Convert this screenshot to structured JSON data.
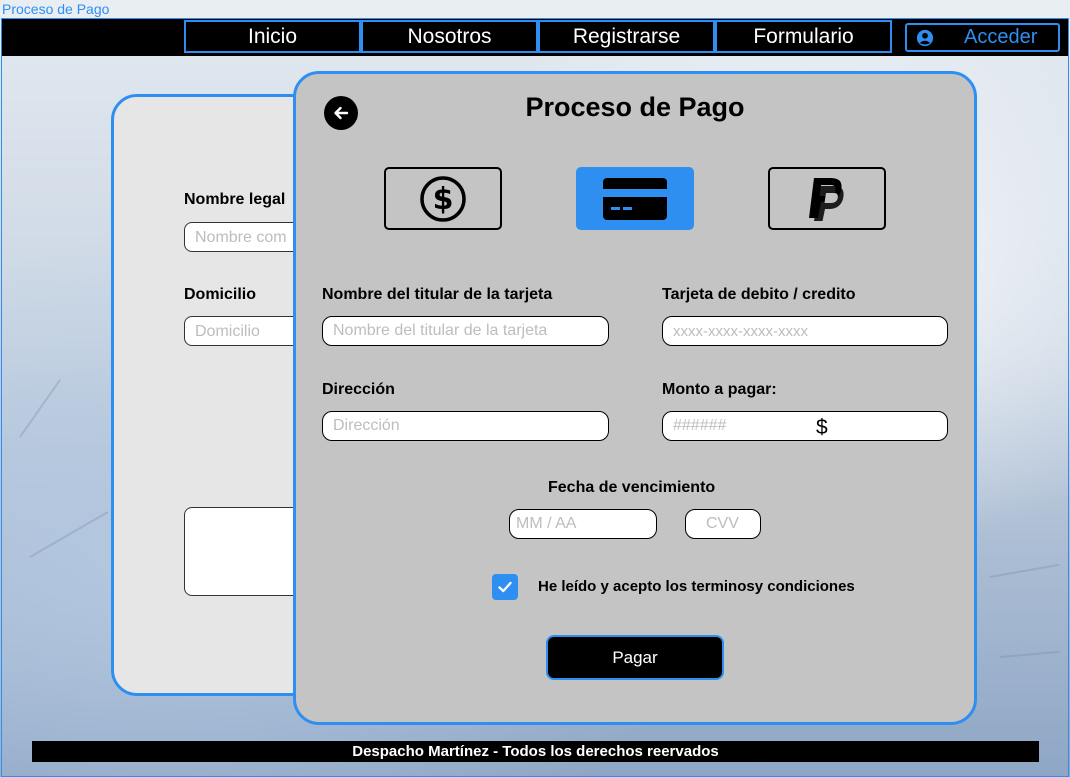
{
  "window": {
    "tab_title": "Proceso de Pago"
  },
  "navbar": {
    "items": [
      {
        "label": "Inicio"
      },
      {
        "label": "Nosotros"
      },
      {
        "label": "Registrarse"
      },
      {
        "label": "Formulario"
      }
    ],
    "login_label": "Acceder"
  },
  "background_form": {
    "name_label": "Nombre legal",
    "name_placeholder": "Nombre com",
    "address_label": "Domicilio",
    "address_placeholder": "Domicilio"
  },
  "payment": {
    "title": "Proceso de Pago",
    "methods": [
      {
        "icon": "cash-dollar-icon",
        "selected": false
      },
      {
        "icon": "credit-card-icon",
        "selected": true
      },
      {
        "icon": "paypal-icon",
        "selected": false
      }
    ],
    "card_holder_label": "Nombre del titular de la tarjeta",
    "card_holder_placeholder": "Nombre del titular de la tarjeta",
    "card_number_label": "Tarjeta de debito / credito",
    "card_number_placeholder": "xxxx-xxxx-xxxx-xxxx",
    "address_label": "Dirección",
    "address_placeholder": "Dirección",
    "amount_label": "Monto a pagar:",
    "amount_placeholder": "######",
    "amount_currency": "$",
    "expiry_label": "Fecha de vencimiento",
    "expiry_placeholder": "MM / AA",
    "cvv_placeholder": "CVV",
    "terms_checked": true,
    "terms_label": "He leído y acepto los terminosy condiciones",
    "pay_button": "Pagar"
  },
  "footer": {
    "text": "Despacho Martínez   -  Todos los derechos reervados"
  },
  "colors": {
    "accent": "#2f8ff0",
    "panel": "#c4c4c4",
    "back_panel": "#e6e6e6"
  }
}
